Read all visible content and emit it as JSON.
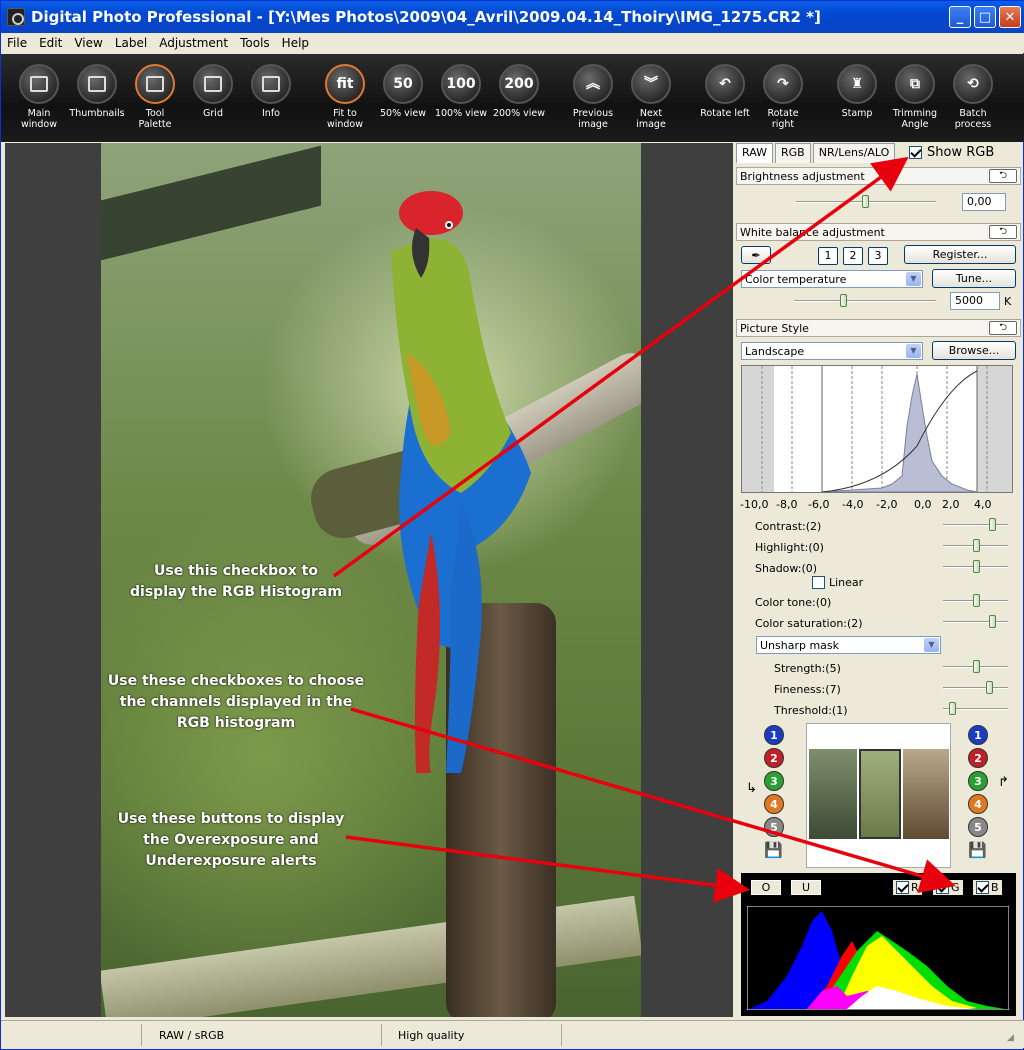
{
  "window": {
    "title": "Digital Photo Professional - [Y:\\Mes Photos\\2009\\04_Avril\\2009.04.14_Thoiry\\IMG_1275.CR2 *]"
  },
  "menu": [
    "File",
    "Edit",
    "View",
    "Label",
    "Adjustment",
    "Tools",
    "Help"
  ],
  "toolbar": [
    {
      "l1": "Main",
      "l2": "window",
      "icon": "main-window-icon"
    },
    {
      "l1": "Thumbnails",
      "l2": "",
      "icon": "thumbnails-icon"
    },
    {
      "l1": "Tool",
      "l2": "Palette",
      "icon": "tool-palette-icon"
    },
    {
      "l1": "Grid",
      "l2": "",
      "icon": "grid-icon"
    },
    {
      "l1": "Info",
      "l2": "",
      "icon": "info-icon"
    },
    {
      "l1": "Fit to",
      "l2": "window",
      "icon": "fit-icon",
      "glyph": "fit"
    },
    {
      "l1": "50% view",
      "l2": "",
      "icon": "zoom-50-icon",
      "glyph": "50"
    },
    {
      "l1": "100% view",
      "l2": "",
      "icon": "zoom-100-icon",
      "glyph": "100"
    },
    {
      "l1": "200% view",
      "l2": "",
      "icon": "zoom-200-icon",
      "glyph": "200"
    },
    {
      "l1": "Previous",
      "l2": "image",
      "icon": "previous-image-icon",
      "glyph": "︽"
    },
    {
      "l1": "Next",
      "l2": "image",
      "icon": "next-image-icon",
      "glyph": "︾"
    },
    {
      "l1": "Rotate left",
      "l2": "",
      "icon": "rotate-left-icon",
      "glyph": "↶"
    },
    {
      "l1": "Rotate right",
      "l2": "",
      "icon": "rotate-right-icon",
      "glyph": "↷"
    },
    {
      "l1": "Stamp",
      "l2": "",
      "icon": "stamp-icon",
      "glyph": "♜"
    },
    {
      "l1": "Trimming",
      "l2": "Angle",
      "icon": "trimming-angle-icon",
      "glyph": "⧉"
    },
    {
      "l1": "Batch",
      "l2": "process",
      "icon": "batch-process-icon",
      "glyph": "⟲"
    }
  ],
  "annotations": {
    "a1": "Use this checkbox to\ndisplay the RGB Histogram",
    "a2": "Use these checkboxes to choose\nthe channels displayed in the\nRGB histogram",
    "a3": "Use these buttons to display\nthe Overexposure and\nUnderexposure alerts"
  },
  "panel": {
    "tabs": [
      "RAW",
      "RGB",
      "NR/Lens/ALO"
    ],
    "show_rgb": "Show RGB",
    "brightness": {
      "title": "Brightness adjustment",
      "value": "0,00"
    },
    "wb": {
      "title": "White balance adjustment",
      "presets": [
        "1",
        "2",
        "3"
      ],
      "register": "Register...",
      "mode": "Color temperature",
      "tune": "Tune...",
      "temp": "5000",
      "unit": "K"
    },
    "ps": {
      "title": "Picture Style",
      "style": "Landscape",
      "browse": "Browse...",
      "axis": [
        "-10,0",
        "-8,0",
        "-6,0",
        "-4,0",
        "-2,0",
        "0,0",
        "2,0",
        "4,0"
      ],
      "contrast": "Contrast:(2)",
      "highlight": "Highlight:(0)",
      "shadow": "Shadow:(0)",
      "linear": "Linear",
      "tone": "Color tone:(0)",
      "saturation": "Color saturation:(2)",
      "sharp_mode": "Unsharp mask",
      "strength": "Strength:(5)",
      "fineness": "Fineness:(7)",
      "threshold": "Threshold:(1)"
    },
    "slots": [
      "1",
      "2",
      "3",
      "4",
      "5"
    ],
    "rgb": {
      "o": "O",
      "u": "U",
      "r": "R",
      "g": "G",
      "b": "B"
    }
  },
  "status": {
    "mode": "RAW / sRGB",
    "quality": "High quality"
  }
}
